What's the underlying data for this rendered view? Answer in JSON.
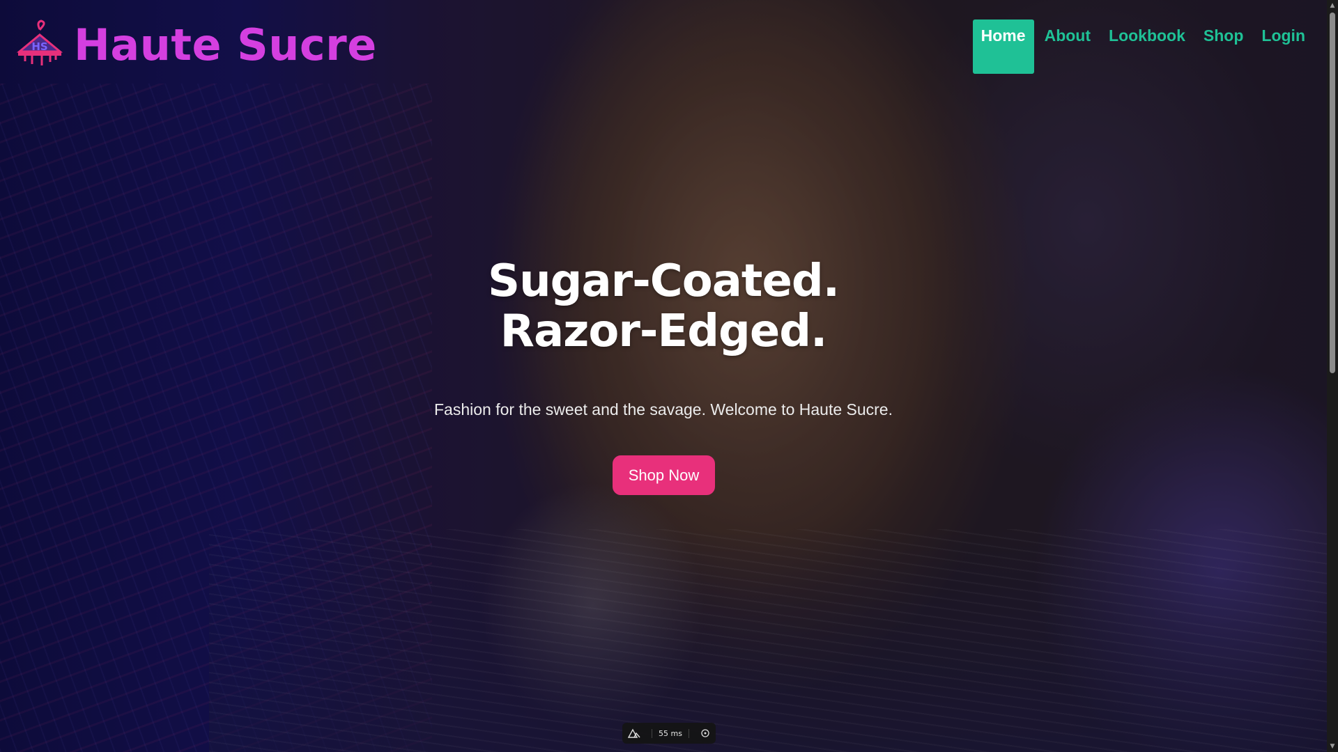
{
  "brand": {
    "name": "Haute Sucre",
    "logo_icon": "hanger-hs-logo-icon",
    "logo_text": "HS",
    "color": "#d43fe0"
  },
  "nav": {
    "items": [
      {
        "label": "Home",
        "active": true
      },
      {
        "label": "About",
        "active": false
      },
      {
        "label": "Lookbook",
        "active": false
      },
      {
        "label": "Shop",
        "active": false
      },
      {
        "label": "Login",
        "active": false
      }
    ],
    "accent": "#1fc196"
  },
  "hero": {
    "headline_line1": "Sugar-Coated.",
    "headline_line2": "Razor-Edged.",
    "tagline": "Fashion for the sweet and the savage. Welcome to Haute Sucre.",
    "cta_label": "Shop Now",
    "cta_color": "#e8307b"
  },
  "perf_widget": {
    "icon": "triangle-logo-icon",
    "value": "55 ms",
    "target_icon": "crosshair-icon"
  }
}
